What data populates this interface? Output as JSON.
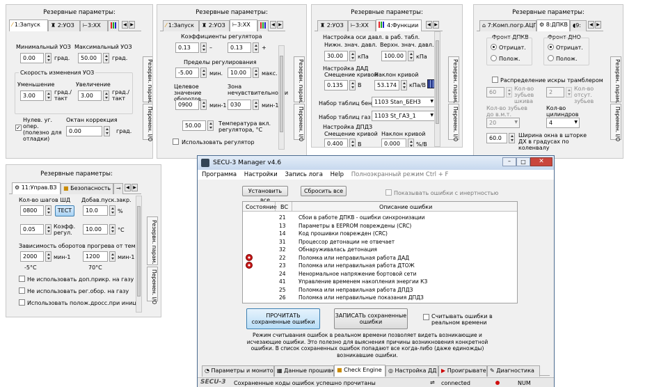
{
  "panel1": {
    "title": "Резервные параметры:",
    "tabs": [
      "1:Запуск",
      "2:УОЗ",
      "3:ХХ"
    ],
    "min_uoz_label": "Минимальный УОЗ",
    "min_uoz": "0.00",
    "min_uoz_unit": "град.",
    "max_uoz_label": "Максимальный УОЗ",
    "max_uoz": "50.00",
    "max_uoz_unit": "град.",
    "speed_label": "Скорость изменения УОЗ",
    "dec_label": "Уменьшение",
    "dec_val": "3.00",
    "dec_unit": "град./такт",
    "inc_label": "Увеличение",
    "inc_val": "3.00",
    "inc_unit": "град./такт",
    "zero_label": "Нулев. уг. опер. (полезно для отладки)",
    "octane_label": "Октан коррекция",
    "octane_val": "0.00",
    "octane_unit": "град.",
    "side_tabs": [
      "Резервн. парам.",
      "Перемен. I/O"
    ]
  },
  "panel2": {
    "title": "Резервные параметры:",
    "tabs": [
      "1:Запуск",
      "2:УОЗ",
      "3:ХХ"
    ],
    "coef_label": "Коэффициенты регулятора",
    "coef_a": "0.13",
    "coef_minus": "–",
    "coef_b": "0.13",
    "coef_plus": "+",
    "limits_label": "Пределы регулирования",
    "lim_min": "-5.00",
    "lim_min_unit": "мин.",
    "lim_max": "10.00",
    "lim_max_unit": "макс.",
    "target_label": "Целевое значение оборотов",
    "target_val": "0900",
    "target_unit": "мин-1",
    "zone_label": "Зона нечувствительности",
    "zone_val": "030",
    "zone_unit": "мин-1",
    "temp_val": "50.00",
    "temp_label": "Температура вкл. регулятора, °С",
    "use_reg_label": "Использовать регулятор",
    "side_tabs": [
      "Резервн. парам.",
      "Перемен. I/O"
    ]
  },
  "panel3": {
    "title": "Резервные параметры:",
    "tabs": [
      "2:УОЗ",
      "3:ХХ",
      "4:Функции"
    ],
    "axis_label": "Настройка оси давл. в раб. табл.",
    "low_label": "Нижн. знач. давл.",
    "low_val": "30.00",
    "low_unit": "кПа",
    "high_label": "Верхн. знач. давл.",
    "high_val": "100.00",
    "high_unit": "кПа",
    "dad_label": "Настройка ДАД",
    "offset_label": "Смещение кривой",
    "offset_val": "0.135",
    "offset_unit": "В",
    "slope_label": "Наклон кривой",
    "slope_val": "53.174",
    "slope_unit": "кПа/В",
    "petrol_label": "Набор таблиц бенз.",
    "petrol_val": "1103 Stan_БЕНЗ",
    "gas_label": "Набор таблиц газ",
    "gas_val": "1103 St_ГАЗ_1",
    "dpdz_label": "Настройка ДПДЗ",
    "dpdz_offset_label": "Смещение кривой",
    "dpdz_offset_val": "0.400",
    "dpdz_offset_unit": "В",
    "dpdz_slope_label": "Наклон кривой",
    "dpdz_slope_val": "0.000",
    "dpdz_slope_unit": "%/В",
    "side_tabs": [
      "Резервн. парам.",
      "Перемен. I/O"
    ]
  },
  "panel4": {
    "title": "Резервные параметры:",
    "tabs": [
      "7:Комп.погр.АЦП",
      "8:ДПКВ",
      "9:"
    ],
    "front_dpkv_label": "Фронт ДПКВ",
    "front_dno_label": "Фронт ДНО",
    "neg_label": "Отрицат.",
    "pos_label": "Полож.",
    "distr_label": "Распределение искры трамблером",
    "teeth_val": "60",
    "teeth_label": "Кол-во зубьев шкива",
    "missing_val": "2",
    "missing_label": "Кол-во отсут. зубьев",
    "teeth_tdc_label": "Кол-во зубьев до в.м.т.",
    "teeth_tdc_val": "20",
    "cyl_label": "Кол-во цилиндров двигателя",
    "cyl_val": "4",
    "window_val": "60.0",
    "window_label": "Ширина окна в шторке ДХ в градусах по коленвалу",
    "side_tabs": [
      "Резервн. парам.",
      "Перемен. I/O"
    ]
  },
  "panel5": {
    "title": "Резервные параметры:",
    "tabs": [
      "11:Управ.ВЗ",
      "Безопасность"
    ],
    "steps_label": "Кол-во шагов ШД",
    "steps_val": "0800",
    "test_btn": "ТЕСТ",
    "add_label": "Добав.пуск.закр.",
    "add_val": "10.0",
    "add_unit": "%",
    "coef_val": "0.05",
    "coef_label": "Коэфф. регул.",
    "coef2_val": "10.00",
    "coef2_unit": "°С",
    "dep_label": "Зависимость оборотов прогрева от темп.",
    "rpm1": "2000",
    "rpm1_unit": "мин-1",
    "rpm2": "1200",
    "rpm2_unit": "мин-1",
    "t1": "-5°C",
    "t2": "70°C",
    "cb1": "Не использовать доп.прикр. на газу",
    "cb2": "Не использовать рег.обор. на газу",
    "cb3": "Использовать полож.дросс.при иниц.",
    "side_tabs": [
      "Резервн. парам.",
      "Перемен. I/O"
    ]
  },
  "window": {
    "title": "SECU-3 Manager v4.6",
    "menu": [
      "Программа",
      "Настройки",
      "Запись лога",
      "Help",
      "Полноэкранный режим Ctrl + F"
    ],
    "btn_set_all": "Установить все",
    "btn_reset_all": "Сбросить все",
    "inertia_label": "Показывать ошибки с инертностью",
    "col_state": "Состояние",
    "col_bc": "ВС",
    "col_desc": "Описание ошибки",
    "errors": [
      {
        "code": "21",
        "desc": "Сбои в работе ДПКВ - ошибки синхронизации"
      },
      {
        "code": "13",
        "desc": "Параметры в EEPROM повреждены (CRC)"
      },
      {
        "code": "14",
        "desc": "Код прошивки поврежден (CRC)"
      },
      {
        "code": "31",
        "desc": "Процессор детонации не отвечает"
      },
      {
        "code": "32",
        "desc": "Обнаруживалась детонация"
      },
      {
        "code": "22",
        "desc": "Поломка или неправильная работа ДАД"
      },
      {
        "code": "23",
        "desc": "Поломка или неправильная работа ДТОЖ"
      },
      {
        "code": "24",
        "desc": "Ненормальное напряжение бортовой сети"
      },
      {
        "code": "41",
        "desc": "Управление временем накопления энергии КЗ"
      },
      {
        "code": "25",
        "desc": "Поломка или неправильная работа ДПДЗ"
      },
      {
        "code": "26",
        "desc": "Поломка или неправильные показания ДПДЗ"
      }
    ],
    "btn_read": "ПРОЧИТАТЬ сохраненные ошибки",
    "btn_write": "ЗАПИСАТЬ сохраненные ошибки",
    "realtime_label": "Считывать ошибки в реальном времени",
    "info": "Режим считывания ошибок в реальном времени позволяет видеть возникающие и исчезающие ошибки. Это полезно для выяснения причины возникновения конкретной ошибки. В список сохраненных ошибок попадают все когда-либо (даже единожды) возникавшие ошибки.",
    "bottom_tabs": [
      "Параметры и монитор",
      "Данные прошивки",
      "Check Engine",
      "Настройка ДД",
      "Проигрыватель",
      "Диагностика"
    ],
    "status_logo": "SECU-3",
    "status_text": "Сохраненные коды ошибок успешно прочитаны",
    "status_conn": "connected",
    "status_num": "NUM",
    "colors": {
      "titlebar": "#dbe6f4",
      "close": "#c9463d",
      "info_text": "#000"
    }
  }
}
